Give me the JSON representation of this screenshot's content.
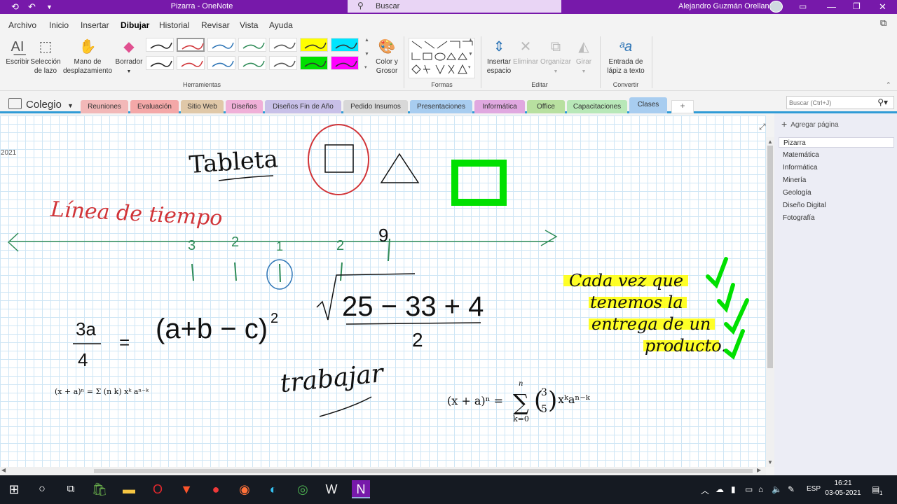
{
  "titlebar": {
    "title": "Pizarra  -  OneNote",
    "search_placeholder": "Buscar",
    "user_name": "Alejandro Guzmán Orellana"
  },
  "menu": {
    "items": [
      "Archivo",
      "Inicio",
      "Insertar",
      "Dibujar",
      "Historial",
      "Revisar",
      "Vista",
      "Ayuda"
    ],
    "active": "Dibujar"
  },
  "ribbon": {
    "tools": {
      "write": "Escribir",
      "lasso_1": "Selección",
      "lasso_2": "de lazo",
      "pan_1": "Mano de",
      "pan_2": "desplazamiento",
      "eraser": "Borrador",
      "color_1": "Color y",
      "color_2": "Grosor"
    },
    "group_tools": "Herramientas",
    "group_shapes": "Formas",
    "edit": {
      "insert_1": "Insertar",
      "insert_2": "espacio",
      "delete": "Eliminar",
      "arrange": "Organizar",
      "rotate": "Girar"
    },
    "group_edit": "Editar",
    "convert_1": "Entrada de",
    "convert_2": "lápiz a texto",
    "group_convert": "Convertir",
    "pen_colors": [
      "#222222",
      "#d13438",
      "#2e75b6",
      "#2e8b57",
      "#555555",
      "#ffff00",
      "#00e5ff",
      "#222222",
      "#d13438",
      "#2e75b6",
      "#2e8b57",
      "#555555",
      "#00e000",
      "#ff00ff"
    ]
  },
  "notebook": {
    "name": "Colegio",
    "tabs": [
      {
        "label": "Reuniones",
        "color": "#f2b8b8"
      },
      {
        "label": "Evaluación",
        "color": "#f4a8a8"
      },
      {
        "label": "Sitio Web",
        "color": "#e0c8a8"
      },
      {
        "label": "Diseños",
        "color": "#f0b0d8"
      },
      {
        "label": "Diseños Fin de Año",
        "color": "#c8c0e8"
      },
      {
        "label": "Pedido Insumos",
        "color": "#d8d8d8"
      },
      {
        "label": "Presentaciones",
        "color": "#a8cdf0"
      },
      {
        "label": "Informática",
        "color": "#e0a8e0"
      },
      {
        "label": "Office",
        "color": "#b8e0a0"
      },
      {
        "label": "Capacitaciones",
        "color": "#b8e8b8"
      },
      {
        "label": "Clases",
        "color": "#a8cdf0"
      }
    ],
    "active_tab": "Clases",
    "add_tab": "+",
    "search_placeholder": "Buscar (Ctrl+J)"
  },
  "pages": {
    "add_label": "Agregar página",
    "items": [
      "Pizarra",
      "Matemática",
      "Informática",
      "Minería",
      "Geología",
      "Diseño Digital",
      "Fotografía"
    ],
    "active": "Pizarra"
  },
  "canvas": {
    "date_fragment": "2021",
    "ink_tableta": "Tableta",
    "ink_linea": "Línea de tiempo",
    "ink_timeline_nums": [
      "3",
      "2",
      "1",
      "2",
      "9"
    ],
    "ink_frac_num": "3a",
    "ink_frac_den": "4",
    "ink_eq": "=",
    "ink_paren": "(a+b − c)",
    "ink_exp": "2",
    "ink_sqrt": "25 − 33 + 4",
    "ink_sqrt_den": "2",
    "ink_trabajar": "trabajar",
    "ink_note": [
      "Cada vez que",
      "tenemos la",
      "entrega de un",
      "producto."
    ],
    "formula_small": "(x + a)ⁿ = Σ (n k) xᵏ aⁿ⁻ᵏ",
    "formula_large_lhs": "(x + a)ⁿ =",
    "formula_large_sum_top": "n",
    "formula_large_sum_bottom": "k=0",
    "formula_large_binom": [
      "3",
      "5"
    ],
    "formula_large_rhs": "xᵏaⁿ⁻ᵏ"
  },
  "taskbar": {
    "language": "ESP",
    "time": "16:21",
    "date": "03-05-2021",
    "notif_count": "1"
  }
}
